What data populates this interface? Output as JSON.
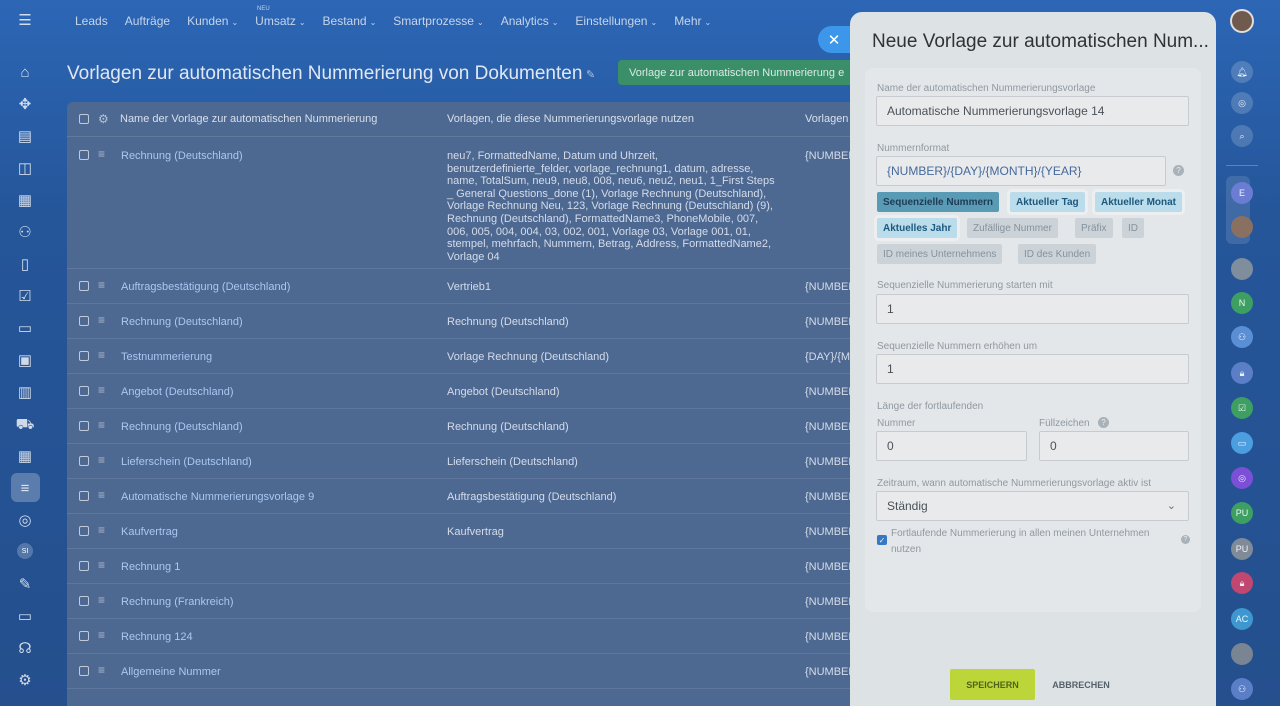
{
  "nav": {
    "items": [
      "Leads",
      "Aufträge",
      "Kunden",
      "Umsatz",
      "Bestand",
      "Smartprozesse",
      "Analytics",
      "Einstellungen",
      "Mehr"
    ],
    "dropdown_flags": [
      false,
      false,
      true,
      true,
      true,
      true,
      true,
      true,
      true
    ],
    "new_badge": "NEU"
  },
  "page": {
    "title": "Vorlagen zur automatischen Nummerierung von Dokumenten",
    "create_button": "Vorlage zur automatischen Nummerierung e"
  },
  "table": {
    "headers": [
      "Name der Vorlage zur automatischen Nummerierung",
      "Vorlagen, die diese Nummerierungsvorlage nutzen",
      "Vorlagen"
    ],
    "rows": [
      {
        "name": "Rechnung (Deutschland)",
        "used_by": "neu7, FormattedName, Datum und Uhrzeit, benutzerdefinierte_felder, vorlage_rechnung1, datum, adresse, name, TotalSum, neu9, neu8, 008, neu6, neu2, neu1, 1_First Steps _ General Questions_done (1), Vorlage Rechnung (Deutschland), Vorlage Rechnung Neu, 123, Vorlage Rechnung (Deutschland) (9), Rechnung (Deutschland), FormattedName3, PhoneMobile, 007, 006, 005, 004, 004, 03, 002, 001, Vorlage 03, Vorlage 001, 01, stempel, mehrfach, Nummern, Betrag, Address, FormattedName2, Vorlage 04",
        "format": "{NUMBER}"
      },
      {
        "name": "Auftragsbestätigung (Deutschland)",
        "used_by": "Vertrieb1",
        "format": "{NUMBER}"
      },
      {
        "name": "Rechnung (Deutschland)",
        "used_by": "Rechnung (Deutschland)",
        "format": "{NUMBER}"
      },
      {
        "name": "Testnummerierung",
        "used_by": "Vorlage Rechnung (Deutschland)",
        "format": "{DAY}/{M"
      },
      {
        "name": "Angebot (Deutschland)",
        "used_by": "Angebot (Deutschland)",
        "format": "{NUMBER}"
      },
      {
        "name": "Rechnung (Deutschland)",
        "used_by": "Rechnung (Deutschland)",
        "format": "{NUMBER}"
      },
      {
        "name": "Lieferschein (Deutschland)",
        "used_by": "Lieferschein (Deutschland)",
        "format": "{NUMBER}"
      },
      {
        "name": "Automatische Nummerierungsvorlage 9",
        "used_by": "Auftragsbestätigung (Deutschland)",
        "format": "{NUMBER}"
      },
      {
        "name": "Kaufvertrag",
        "used_by": "Kaufvertrag",
        "format": "{NUMBER}"
      },
      {
        "name": "Rechnung 1",
        "used_by": "",
        "format": "{NUMBER}"
      },
      {
        "name": "Rechnung (Frankreich)",
        "used_by": "",
        "format": "{NUMBER}"
      },
      {
        "name": "Rechnung 124",
        "used_by": "",
        "format": "{NUMBER}"
      },
      {
        "name": "Allgemeine Nummer",
        "used_by": "",
        "format": "{NUMBER}"
      }
    ]
  },
  "panel": {
    "title": "Neue Vorlage zur automatischen Num...",
    "name_label": "Name der automatischen Nummerierungsvorlage",
    "name_value": "Automatische Nummerierungsvorlage  14",
    "format_label": "Nummernformat",
    "format_value": "{NUMBER}/{DAY}/{MONTH}/{YEAR}",
    "tags": [
      "Sequenzielle Nummern",
      "Aktueller Tag",
      "Aktueller Monat",
      "Aktuelles Jahr",
      "Zufällige Nummer",
      "Präfix",
      "ID",
      "ID meines Unternehmens",
      "ID des Kunden"
    ],
    "start_label": "Sequenzielle Nummerierung starten mit",
    "start_value": "1",
    "step_label": "Sequenzielle Nummern erhöhen um",
    "step_value": "1",
    "length_label": "Länge der fortlaufenden",
    "length_label2": "Nummer",
    "length_value": "0",
    "fill_label": "Füllzeichen",
    "fill_value": "0",
    "period_label": "Zeitraum, wann automatische Nummerierungsvorlage aktiv ist",
    "period_value": "Ständig",
    "checkbox_label": "Fortlaufende Nummerierung in allen meinen Unternehmen nutzen",
    "checkbox_checked": true,
    "save": "SPEICHERN",
    "cancel": "ABBRECHEN"
  },
  "left_sidebar": {
    "selected_index": 12,
    "si_badge": "SI"
  },
  "right_sidebar": {
    "badges": [
      "N",
      "PU",
      "PU",
      "AC"
    ]
  },
  "colors": {
    "panel_bg": "#eef2f5",
    "save_button": "#bcd63a",
    "tag_selected": "#5fa4c0",
    "tag_highlight": "#c9ecfb",
    "link": "#a9c8f3"
  }
}
